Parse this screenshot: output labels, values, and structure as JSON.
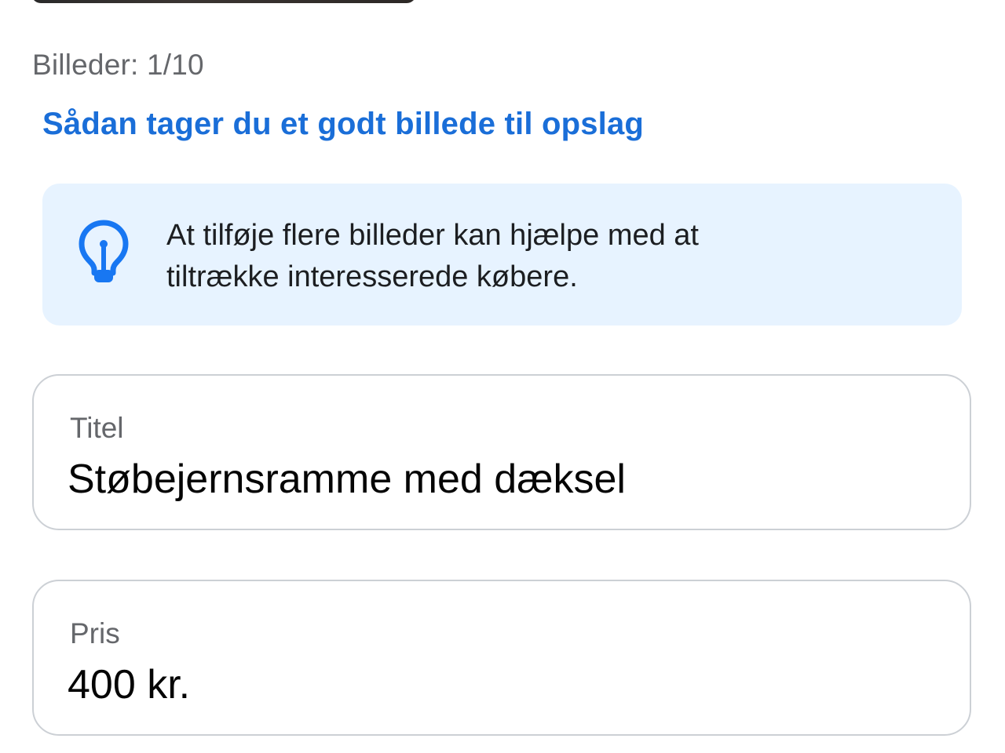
{
  "photos": {
    "count_label": "Billeder: 1/10",
    "tip_link": "Sådan tager du et godt billede til opslag"
  },
  "tip": {
    "icon": "lightbulb-icon",
    "line1": "At tilføje flere billeder kan hjælpe med at",
    "line2": "tiltrække interesserede købere."
  },
  "form": {
    "title": {
      "label": "Titel",
      "value": "Støbejernsramme med dæksel"
    },
    "price": {
      "label": "Pris",
      "value": "400 kr."
    }
  },
  "colors": {
    "link": "#1a6ed8",
    "tip_background": "#e7f3ff",
    "icon": "#1877f2"
  }
}
